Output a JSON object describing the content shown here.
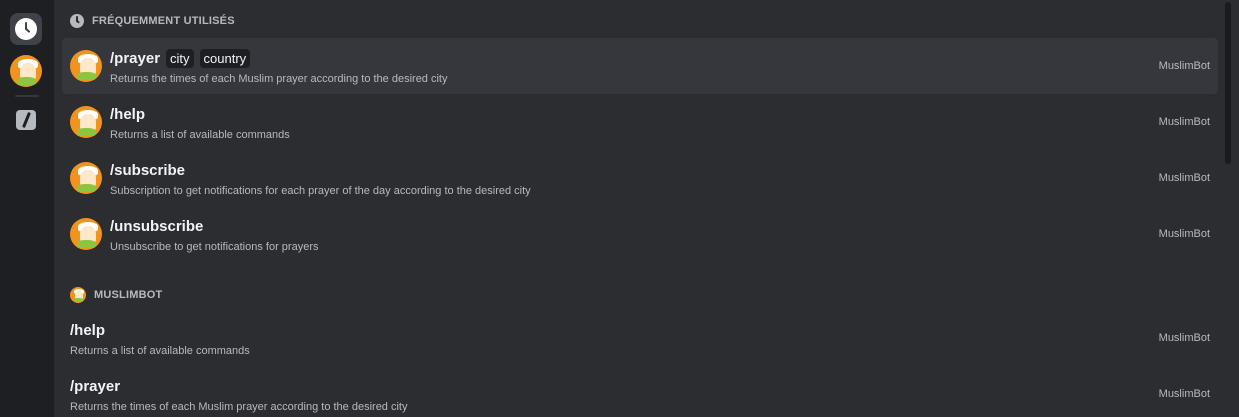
{
  "rail": {
    "recent_icon": "clock-icon",
    "bot_icon": "muslimbot-avatar",
    "builtin_icon": "slash-command-icon"
  },
  "sections": {
    "recent": {
      "title": "FRÉQUEMMENT UTILISÉS",
      "icon": "clock-icon"
    },
    "bot": {
      "title": "MUSLIMBOT",
      "icon": "muslimbot-avatar"
    }
  },
  "recent_commands": [
    {
      "name": "/prayer",
      "options": [
        "city",
        "country"
      ],
      "description": "Returns the times of each Muslim prayer according to the desired city",
      "source": "MuslimBot"
    },
    {
      "name": "/help",
      "options": [],
      "description": "Returns a list of available commands",
      "source": "MuslimBot"
    },
    {
      "name": "/subscribe",
      "options": [],
      "description": "Subscription to get notifications for each prayer of the day according to the desired city",
      "source": "MuslimBot"
    },
    {
      "name": "/unsubscribe",
      "options": [],
      "description": "Unsubscribe to get notifications for prayers",
      "source": "MuslimBot"
    }
  ],
  "bot_commands": [
    {
      "name": "/help",
      "description": "Returns a list of available commands",
      "source": "MuslimBot"
    },
    {
      "name": "/prayer",
      "description": "Returns the times of each Muslim prayer according to the desired city",
      "source": "MuslimBot"
    }
  ],
  "colors": {
    "background": "#2b2d31",
    "rail": "#1e1f22",
    "active_row": "#35373c",
    "avatar": "#f0941e"
  }
}
